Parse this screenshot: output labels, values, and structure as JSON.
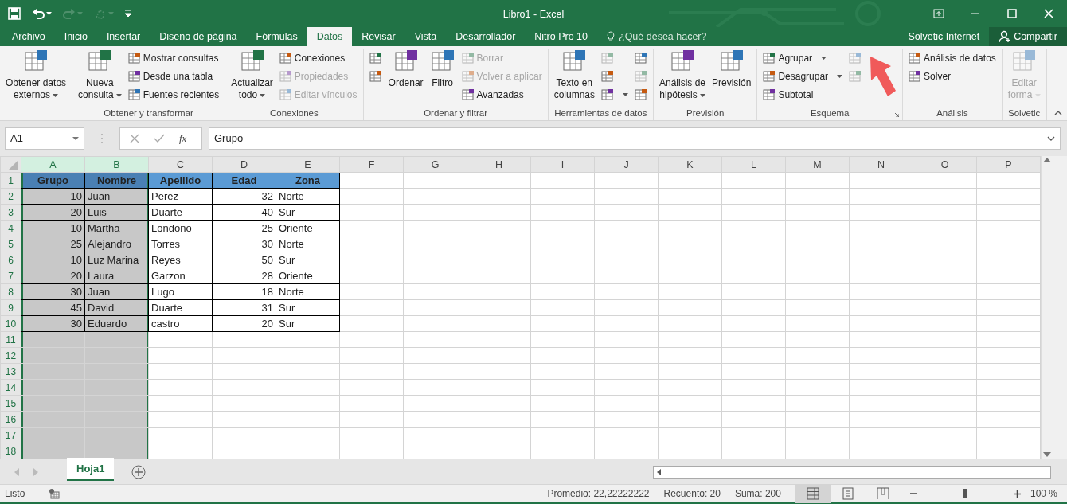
{
  "window": {
    "title": "Libro1 - Excel"
  },
  "quick_access": [
    {
      "disabled": false,
      "dropdown": false
    },
    {
      "disabled": false,
      "dropdown": true
    },
    {
      "disabled": true,
      "dropdown": true
    },
    {
      "disabled": true,
      "dropdown": true
    }
  ],
  "tabs": [
    {
      "label": "Archivo",
      "selected": false
    },
    {
      "label": "Inicio",
      "selected": false
    },
    {
      "label": "Insertar",
      "selected": false
    },
    {
      "label": "Diseño de página",
      "selected": false
    },
    {
      "label": "Fórmulas",
      "selected": false
    },
    {
      "label": "Datos",
      "selected": true
    },
    {
      "label": "Revisar",
      "selected": false
    },
    {
      "label": "Vista",
      "selected": false
    },
    {
      "label": "Desarrollador",
      "selected": false
    },
    {
      "label": "Nitro Pro 10",
      "selected": false
    }
  ],
  "tell_me": {
    "placeholder": "¿Qué desea hacer?"
  },
  "user": "Solvetic Internet",
  "share_button": "Compartir",
  "ribbon": [
    {
      "items": [
        {
          "kind": "large",
          "label": "Obtener datos\nexternos",
          "dropdown": true,
          "disabled": false
        }
      ]
    },
    {
      "label": "Obtener y transformar",
      "items": [
        {
          "kind": "large",
          "label": "Nueva\nconsulta",
          "dropdown": true,
          "disabled": false
        },
        {
          "kind": "stack",
          "items": [
            {
              "label": "Mostrar consultas",
              "disabled": false
            },
            {
              "label": "Desde una tabla",
              "disabled": false
            },
            {
              "label": "Fuentes recientes",
              "disabled": false
            }
          ]
        }
      ]
    },
    {
      "label": "Conexiones",
      "items": [
        {
          "kind": "large",
          "label": "Actualizar\ntodo",
          "dropdown": true,
          "disabled": false
        },
        {
          "kind": "stack",
          "items": [
            {
              "label": "Conexiones",
              "disabled": false
            },
            {
              "label": "Propiedades",
              "disabled": true
            },
            {
              "label": "Editar vínculos",
              "disabled": true
            }
          ]
        }
      ]
    },
    {
      "label": "Ordenar y filtrar",
      "items": [
        {
          "kind": "stack",
          "items": [
            {
              "disabled": false
            },
            {
              "disabled": false
            }
          ]
        },
        {
          "kind": "large",
          "label": "Ordenar",
          "dropdown": false,
          "disabled": false
        },
        {
          "kind": "large",
          "label": "Filtro",
          "dropdown": false,
          "disabled": false
        },
        {
          "kind": "stack",
          "items": [
            {
              "label": "Borrar",
              "disabled": true
            },
            {
              "label": "Volver a aplicar",
              "disabled": true
            },
            {
              "label": "Avanzadas",
              "disabled": false
            }
          ]
        }
      ]
    },
    {
      "label": "Herramientas de datos",
      "items": [
        {
          "kind": "large",
          "label": "Texto en\ncolumnas",
          "dropdown": false,
          "disabled": false
        },
        {
          "kind": "stack",
          "items": [
            {
              "disabled": true
            },
            {
              "disabled": false
            },
            {
              "disabled": false,
              "dropdown": true
            }
          ]
        },
        {
          "kind": "stack",
          "items": [
            {
              "disabled": false
            },
            {
              "disabled": true
            },
            {
              "disabled": false
            }
          ]
        }
      ]
    },
    {
      "label": "Previsión",
      "items": [
        {
          "kind": "large",
          "label": "Análisis de\nhipótesis",
          "dropdown": true,
          "disabled": false
        },
        {
          "kind": "large",
          "label": "Previsión",
          "dropdown": false,
          "disabled": false
        }
      ]
    },
    {
      "label": "Esquema",
      "launcher": true,
      "items": [
        {
          "kind": "stack",
          "items": [
            {
              "label": "Agrupar",
              "disabled": false,
              "dropdown": true
            },
            {
              "label": "Desagrupar",
              "disabled": false,
              "dropdown": true
            },
            {
              "label": "Subtotal",
              "disabled": false
            }
          ]
        },
        {
          "kind": "stack",
          "items": [
            {
              "disabled": true
            },
            {
              "disabled": true
            }
          ]
        }
      ]
    },
    {
      "label": "Análisis",
      "items": [
        {
          "kind": "stack",
          "items": [
            {
              "label": "Análisis de datos",
              "disabled": false
            },
            {
              "label": "Solver",
              "disabled": false
            }
          ]
        }
      ]
    },
    {
      "label": "Solvetic",
      "items": [
        {
          "kind": "large",
          "label": "Editar\nforma",
          "dropdown": true,
          "disabled": true
        }
      ]
    }
  ],
  "formula_bar": {
    "name_box": "A1",
    "function_label": "fx",
    "formula": "Grupo"
  },
  "columns": [
    {
      "label": "A",
      "selected": true,
      "numeric": true
    },
    {
      "label": "B",
      "selected": true,
      "numeric": false
    },
    {
      "label": "C",
      "selected": false,
      "numeric": false
    },
    {
      "label": "D",
      "selected": false,
      "numeric": true
    },
    {
      "label": "E",
      "selected": false,
      "numeric": false
    },
    {
      "label": "F",
      "selected": false
    },
    {
      "label": "G",
      "selected": false
    },
    {
      "label": "H",
      "selected": false
    },
    {
      "label": "I",
      "selected": false
    },
    {
      "label": "J",
      "selected": false
    },
    {
      "label": "K",
      "selected": false
    },
    {
      "label": "L",
      "selected": false
    },
    {
      "label": "M",
      "selected": false
    },
    {
      "label": "N",
      "selected": false
    },
    {
      "label": "O",
      "selected": false
    },
    {
      "label": "P",
      "selected": false
    }
  ],
  "rows": [
    {
      "label": "1",
      "kind": "header",
      "cells": [
        "Grupo",
        "Nombre",
        "Apellido",
        "Edad",
        "Zona"
      ]
    },
    {
      "label": "2",
      "kind": "data",
      "cells": [
        "10",
        "Juan",
        "Perez",
        "32",
        "Norte"
      ]
    },
    {
      "label": "3",
      "kind": "data",
      "cells": [
        "20",
        "Luis",
        "Duarte",
        "40",
        "Sur"
      ]
    },
    {
      "label": "4",
      "kind": "data",
      "cells": [
        "10",
        "Martha",
        "Londoño",
        "25",
        "Oriente"
      ]
    },
    {
      "label": "5",
      "kind": "data",
      "cells": [
        "25",
        "Alejandro",
        "Torres",
        "30",
        "Norte"
      ]
    },
    {
      "label": "6",
      "kind": "data",
      "cells": [
        "10",
        "Luz Marina",
        "Reyes",
        "50",
        "Sur"
      ]
    },
    {
      "label": "7",
      "kind": "data",
      "cells": [
        "20",
        "Laura",
        "Garzon",
        "28",
        "Oriente"
      ]
    },
    {
      "label": "8",
      "kind": "data",
      "cells": [
        "30",
        "Juan",
        "Lugo",
        "18",
        "Norte"
      ]
    },
    {
      "label": "9",
      "kind": "data",
      "cells": [
        "45",
        "David",
        "Duarte",
        "31",
        "Sur"
      ]
    },
    {
      "label": "10",
      "kind": "data",
      "cells": [
        "30",
        "Eduardo",
        "castro",
        "20",
        "Sur"
      ]
    },
    {
      "label": "11"
    },
    {
      "label": "12"
    },
    {
      "label": "13"
    },
    {
      "label": "14"
    },
    {
      "label": "15"
    },
    {
      "label": "16"
    },
    {
      "label": "17"
    },
    {
      "label": "18"
    }
  ],
  "sheets": [
    {
      "label": "Hoja1",
      "selected": true
    }
  ],
  "status_bar": {
    "status": "Listo",
    "stats": [
      "Promedio: 22,22222222",
      "Recuento: 20",
      "Suma: 200"
    ],
    "views": [
      {
        "selected": true
      },
      {
        "selected": false
      },
      {
        "selected": false
      }
    ],
    "zoom": {
      "level": 0.5,
      "label": "100 %"
    }
  }
}
